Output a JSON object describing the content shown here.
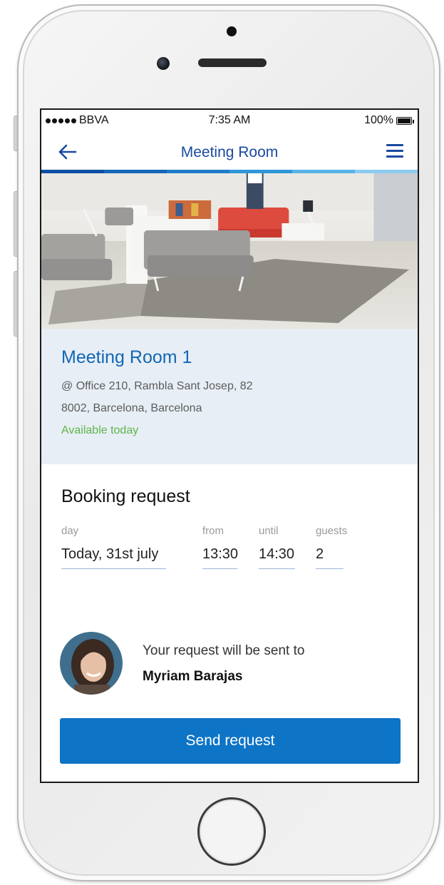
{
  "status_bar": {
    "carrier": "BBVA",
    "time": "7:35 AM",
    "battery_percent": "100%",
    "battery_level": 1.0,
    "signal_bars": 5
  },
  "nav": {
    "back_icon": "arrow-left-icon",
    "title": "Meeting Room",
    "menu_icon": "hamburger-menu-icon"
  },
  "progress_strip_colors": [
    "#0b4fa6",
    "#1565b8",
    "#1f7cc8",
    "#2f97d8",
    "#58b3e6",
    "#8ccbf0"
  ],
  "room": {
    "name": "Meeting Room 1",
    "address_line1": "@ Office 210, Rambla Sant Josep, 82",
    "address_line2": "8002, Barcelona, Barcelona",
    "availability": "Available today"
  },
  "booking": {
    "title": "Booking request",
    "fields": {
      "day": {
        "label": "day",
        "value": "Today,  31st july"
      },
      "from": {
        "label": "from",
        "value": "13:30"
      },
      "until": {
        "label": "until",
        "value": "14:30"
      },
      "guests": {
        "label": "guests",
        "value": "2"
      }
    }
  },
  "recipient": {
    "text": "Your request will be sent to",
    "name": "Myriam Barajas"
  },
  "actions": {
    "send_label": "Send request"
  },
  "colors": {
    "brand_blue": "#1a4aa0",
    "accent_blue": "#0d74c6",
    "room_title_blue": "#1366b4",
    "available_green": "#5eb54b",
    "card_background": "#e7eef5"
  }
}
